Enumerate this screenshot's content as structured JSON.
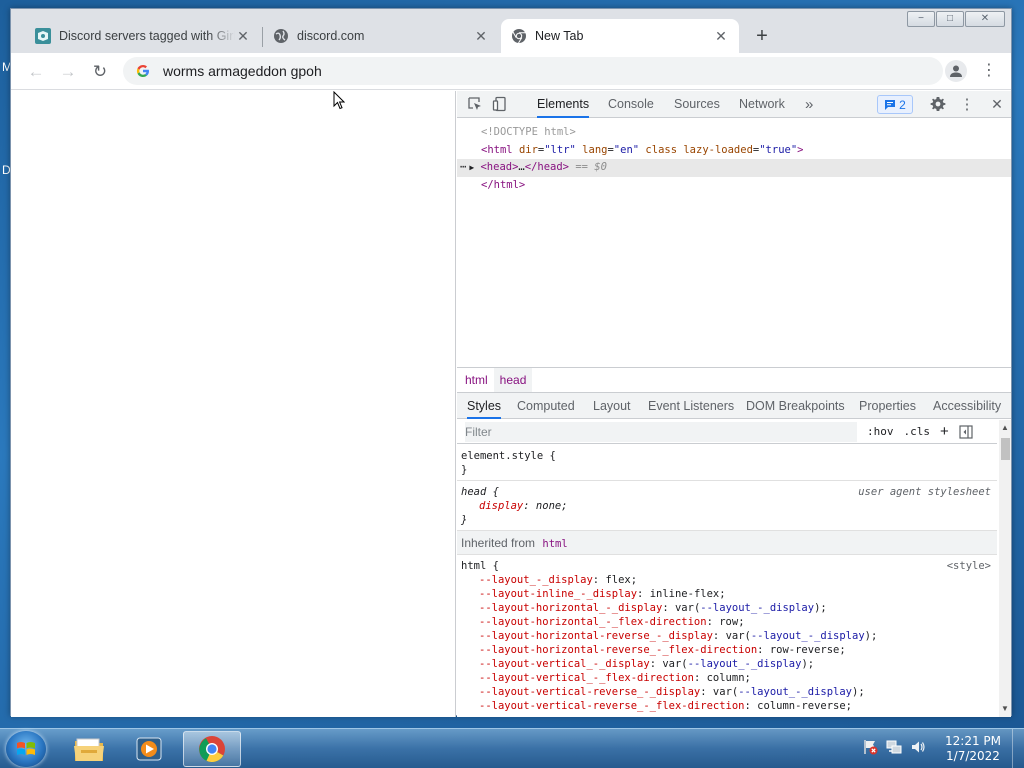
{
  "desktop": {
    "edge_letters": [
      "M",
      "D"
    ]
  },
  "window": {
    "controls": [
      "−",
      "□",
      "✕"
    ],
    "tabs": [
      {
        "title": "Discord servers tagged with Girlf",
        "favicon": "discord-servers-favicon"
      },
      {
        "title": "discord.com",
        "favicon": "globe-icon"
      },
      {
        "title": "New Tab",
        "favicon": "chrome-icon",
        "active": true
      }
    ],
    "new_tab_label": "+"
  },
  "toolbar": {
    "back": "←",
    "forward": "→",
    "reload": "↻",
    "address": "worms armageddon gpoh",
    "menu": "⋮"
  },
  "devtools": {
    "tabs": [
      "Elements",
      "Console",
      "Sources",
      "Network"
    ],
    "more_tabs": "»",
    "issues_count": "2",
    "close": "✕",
    "dom": {
      "doctype": "<!DOCTYPE html>",
      "html_open": {
        "tag_open": "<html",
        "a1_name": "dir",
        "a1_val": "\"ltr\"",
        "a2_name": "lang",
        "a2_val": "\"en\"",
        "a3_name": "class",
        "a4_name": "lazy-loaded",
        "a4_val": "\"true\"",
        "tag_close": ">"
      },
      "head_line": {
        "dots": "⋯",
        "arrow": "▶",
        "tag": "<head>",
        "ellipsis": "…",
        "close_tag": "</head>",
        "eq": "== $0"
      },
      "html_close": "</html>"
    },
    "breadcrumbs": [
      "html",
      "head"
    ],
    "styles_tabs": [
      "Styles",
      "Computed",
      "Layout",
      "Event Listeners",
      "DOM Breakpoints",
      "Properties",
      "Accessibility"
    ],
    "filter_placeholder": "Filter",
    "filter_hov": ":hov",
    "filter_cls": ".cls",
    "filter_plus": "+",
    "element_style": {
      "selector": "element.style {",
      "close": "}"
    },
    "head_rule": {
      "selector": "head {",
      "source": "user agent stylesheet",
      "prop": "display",
      "value": "none;",
      "close": "}"
    },
    "inherited_label": "Inherited from",
    "inherited_tag": "html",
    "html_rule": {
      "selector": "html {",
      "source": "<style>",
      "props": [
        {
          "name": "--layout_-_display",
          "value": "flex;"
        },
        {
          "name": "--layout-inline_-_display",
          "value": "inline-flex;"
        },
        {
          "name": "--layout-horizontal_-_display",
          "pre": "var(",
          "var": "--layout_-_display",
          "post": ");"
        },
        {
          "name": "--layout-horizontal_-_flex-direction",
          "value": "row;"
        },
        {
          "name": "--layout-horizontal-reverse_-_display",
          "pre": "var(",
          "var": "--layout_-_display",
          "post": ");"
        },
        {
          "name": "--layout-horizontal-reverse_-_flex-direction",
          "value": "row-reverse;"
        },
        {
          "name": "--layout-vertical_-_display",
          "pre": "var(",
          "var": "--layout_-_display",
          "post": ");"
        },
        {
          "name": "--layout-vertical_-_flex-direction",
          "value": "column;"
        },
        {
          "name": "--layout-vertical-reverse_-_display",
          "pre": "var(",
          "var": "--layout_-_display",
          "post": ");"
        },
        {
          "name": "--layout-vertical-reverse_-_flex-direction",
          "value": "column-reverse;"
        }
      ]
    }
  },
  "taskbar": {
    "clock_time": "12:21 PM",
    "clock_date": "1/7/2022"
  },
  "colors": {
    "accent": "#1a73e8",
    "tag": "#881280",
    "prop_name": "#c80000"
  }
}
